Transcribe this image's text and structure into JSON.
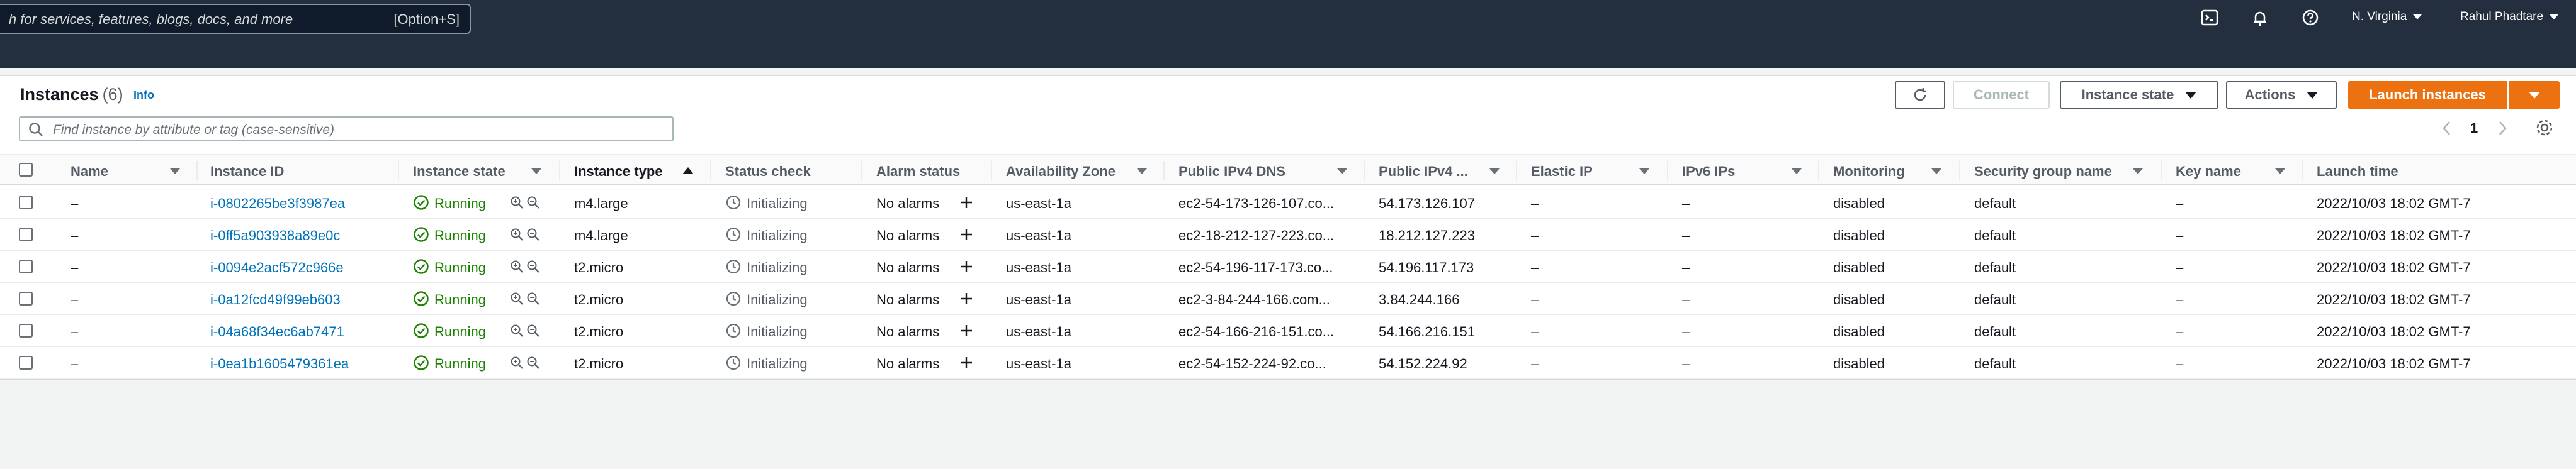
{
  "nav": {
    "search_placeholder": "h for services, features, blogs, docs, and more",
    "search_shortcut": "[Option+S]",
    "region": "N. Virginia",
    "user": "Rahul Phadtare"
  },
  "panel": {
    "title": "Instances",
    "count": "(6)",
    "info": "Info",
    "buttons": {
      "connect": "Connect",
      "instance_state": "Instance state",
      "actions": "Actions",
      "launch": "Launch instances"
    },
    "filter_placeholder": "Find instance by attribute or tag (case-sensitive)",
    "page": "1"
  },
  "columns": {
    "name": "Name",
    "instance_id": "Instance ID",
    "instance_state": "Instance state",
    "instance_type": "Instance type",
    "status_check": "Status check",
    "alarm_status": "Alarm status",
    "az": "Availability Zone",
    "dns": "Public IPv4 DNS",
    "ipv4": "Public IPv4 ...",
    "eip": "Elastic IP",
    "ipv6": "IPv6 IPs",
    "monitoring": "Monitoring",
    "sg": "Security group name",
    "key": "Key name",
    "launch": "Launch time"
  },
  "rows": [
    {
      "name": "–",
      "id": "i-0802265be3f3987ea",
      "state": "Running",
      "type": "m4.large",
      "status": "Initializing",
      "alarm": "No alarms",
      "az": "us-east-1a",
      "dns": "ec2-54-173-126-107.co...",
      "ip": "54.173.126.107",
      "eip": "–",
      "ipv6": "–",
      "mon": "disabled",
      "sg": "default",
      "key": "–",
      "launch": "2022/10/03 18:02 GMT-7"
    },
    {
      "name": "–",
      "id": "i-0ff5a903938a89e0c",
      "state": "Running",
      "type": "m4.large",
      "status": "Initializing",
      "alarm": "No alarms",
      "az": "us-east-1a",
      "dns": "ec2-18-212-127-223.co...",
      "ip": "18.212.127.223",
      "eip": "–",
      "ipv6": "–",
      "mon": "disabled",
      "sg": "default",
      "key": "–",
      "launch": "2022/10/03 18:02 GMT-7"
    },
    {
      "name": "–",
      "id": "i-0094e2acf572c966e",
      "state": "Running",
      "type": "t2.micro",
      "status": "Initializing",
      "alarm": "No alarms",
      "az": "us-east-1a",
      "dns": "ec2-54-196-117-173.co...",
      "ip": "54.196.117.173",
      "eip": "–",
      "ipv6": "–",
      "mon": "disabled",
      "sg": "default",
      "key": "–",
      "launch": "2022/10/03 18:02 GMT-7"
    },
    {
      "name": "–",
      "id": "i-0a12fcd49f99eb603",
      "state": "Running",
      "type": "t2.micro",
      "status": "Initializing",
      "alarm": "No alarms",
      "az": "us-east-1a",
      "dns": "ec2-3-84-244-166.com...",
      "ip": "3.84.244.166",
      "eip": "–",
      "ipv6": "–",
      "mon": "disabled",
      "sg": "default",
      "key": "–",
      "launch": "2022/10/03 18:02 GMT-7"
    },
    {
      "name": "–",
      "id": "i-04a68f34ec6ab7471",
      "state": "Running",
      "type": "t2.micro",
      "status": "Initializing",
      "alarm": "No alarms",
      "az": "us-east-1a",
      "dns": "ec2-54-166-216-151.co...",
      "ip": "54.166.216.151",
      "eip": "–",
      "ipv6": "–",
      "mon": "disabled",
      "sg": "default",
      "key": "–",
      "launch": "2022/10/03 18:02 GMT-7"
    },
    {
      "name": "–",
      "id": "i-0ea1b1605479361ea",
      "state": "Running",
      "type": "t2.micro",
      "status": "Initializing",
      "alarm": "No alarms",
      "az": "us-east-1a",
      "dns": "ec2-54-152-224-92.co...",
      "ip": "54.152.224.92",
      "eip": "–",
      "ipv6": "–",
      "mon": "disabled",
      "sg": "default",
      "key": "–",
      "launch": "2022/10/03 18:02 GMT-7"
    }
  ],
  "colors": {
    "nav_bg": "#232f3e",
    "link": "#0073bb",
    "running": "#1d8102",
    "primary": "#ec7211"
  }
}
